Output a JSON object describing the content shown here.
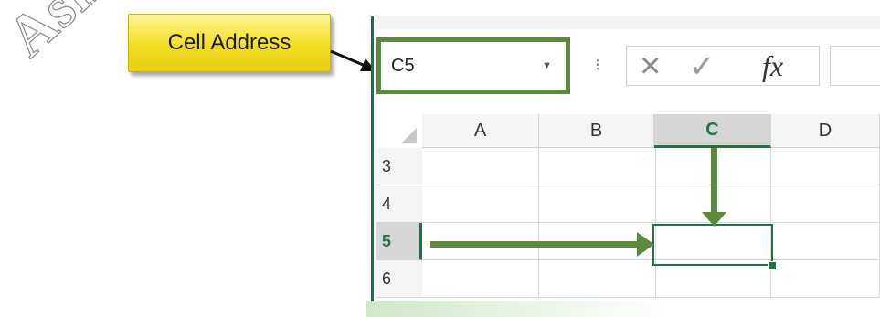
{
  "watermark": "Ashima",
  "callout": {
    "label": "Cell Address"
  },
  "formula_bar": {
    "name_box_value": "C5",
    "separator": "⁝",
    "cancel_icon": "×",
    "enter_icon": "✓",
    "function_label": "fx",
    "formula_value": ""
  },
  "grid": {
    "columns": [
      "A",
      "B",
      "C",
      "D"
    ],
    "rows": [
      "3",
      "4",
      "5",
      "6"
    ],
    "active_column": "C",
    "active_row": "5",
    "selected_cell": "C5"
  },
  "colors": {
    "accent_green": "#217346",
    "arrow_green": "#5b8a3a",
    "callout_yellow": "#f3de22"
  }
}
